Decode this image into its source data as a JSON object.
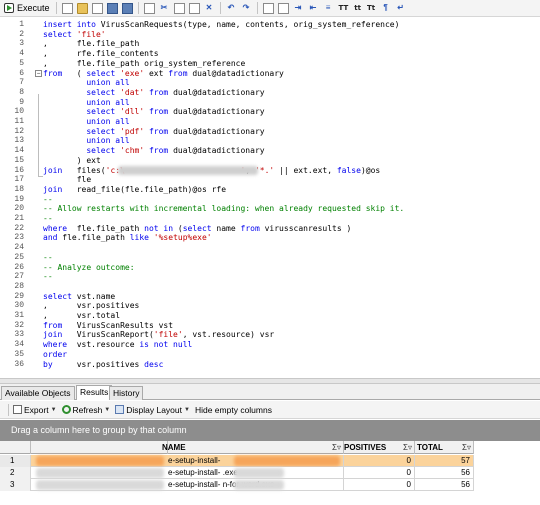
{
  "toolbar": {
    "execute_label": "Execute",
    "tt1": "TT",
    "tt2": "tt",
    "tt3": "Tt"
  },
  "editor": {
    "lines": [
      {
        "n": "1",
        "parts": [
          [
            "kw",
            "insert into "
          ],
          [
            "t",
            "VirusScanRequests(type, name, contents, orig_system_reference)"
          ]
        ]
      },
      {
        "n": "2",
        "parts": [
          [
            "kw",
            "select "
          ],
          [
            "str",
            "'file'"
          ]
        ]
      },
      {
        "n": "3",
        "parts": [
          [
            "t",
            ",      fle.file_path"
          ]
        ]
      },
      {
        "n": "4",
        "parts": [
          [
            "t",
            ",      rfe.file_contents"
          ]
        ]
      },
      {
        "n": "5",
        "parts": [
          [
            "t",
            ",      fle.file_path orig_system_reference"
          ]
        ]
      },
      {
        "n": "6",
        "parts": [
          [
            "kw",
            "from   "
          ],
          [
            "t",
            "( "
          ],
          [
            "kw",
            "select "
          ],
          [
            "str",
            "'exe'"
          ],
          [
            "t",
            " ext "
          ],
          [
            "kw",
            "from "
          ],
          [
            "t",
            "dual@datadictionary"
          ]
        ]
      },
      {
        "n": "7",
        "parts": [
          [
            "kw",
            "         union all"
          ]
        ]
      },
      {
        "n": "8",
        "parts": [
          [
            "kw",
            "         select "
          ],
          [
            "str",
            "'dat'"
          ],
          [
            "kw",
            " from "
          ],
          [
            "t",
            "dual@datadictionary"
          ]
        ]
      },
      {
        "n": "9",
        "parts": [
          [
            "kw",
            "         union all"
          ]
        ]
      },
      {
        "n": "10",
        "parts": [
          [
            "kw",
            "         select "
          ],
          [
            "str",
            "'dll'"
          ],
          [
            "kw",
            " from "
          ],
          [
            "t",
            "dual@datadictionary"
          ]
        ]
      },
      {
        "n": "11",
        "parts": [
          [
            "kw",
            "         union all"
          ]
        ]
      },
      {
        "n": "12",
        "parts": [
          [
            "kw",
            "         select "
          ],
          [
            "str",
            "'pdf'"
          ],
          [
            "kw",
            " from "
          ],
          [
            "t",
            "dual@datadictionary"
          ]
        ]
      },
      {
        "n": "13",
        "parts": [
          [
            "kw",
            "         union all"
          ]
        ]
      },
      {
        "n": "14",
        "parts": [
          [
            "kw",
            "         select "
          ],
          [
            "str",
            "'chm'"
          ],
          [
            "kw",
            " from "
          ],
          [
            "t",
            "dual@datadictionary"
          ]
        ]
      },
      {
        "n": "15",
        "parts": [
          [
            "t",
            "       ) ext"
          ]
        ]
      },
      {
        "n": "16",
        "parts": [
          [
            "kw",
            "join   "
          ],
          [
            "t",
            "files("
          ],
          [
            "str",
            "'c:\\                        '"
          ],
          [
            "t",
            ", "
          ],
          [
            "str",
            "'*.'"
          ],
          [
            "t",
            " || ext.ext, "
          ],
          [
            "kw",
            "false"
          ],
          [
            "t",
            ")@os"
          ]
        ]
      },
      {
        "n": "17",
        "parts": [
          [
            "t",
            "       fle"
          ]
        ]
      },
      {
        "n": "18",
        "parts": [
          [
            "kw",
            "join   "
          ],
          [
            "t",
            "read_file(fle.file_path)@os rfe"
          ]
        ]
      },
      {
        "n": "19",
        "parts": [
          [
            "cm",
            "--"
          ]
        ]
      },
      {
        "n": "20",
        "parts": [
          [
            "cm",
            "-- Allow restarts with incremental loading: when already requested skip it."
          ]
        ]
      },
      {
        "n": "21",
        "parts": [
          [
            "cm",
            "--"
          ]
        ]
      },
      {
        "n": "22",
        "parts": [
          [
            "kw",
            "where  "
          ],
          [
            "t",
            "fle.file_path "
          ],
          [
            "kw",
            "not in "
          ],
          [
            "t",
            "("
          ],
          [
            "kw",
            "select "
          ],
          [
            "t",
            "name "
          ],
          [
            "kw",
            "from "
          ],
          [
            "t",
            "virusscanresults )"
          ]
        ]
      },
      {
        "n": "23",
        "parts": [
          [
            "kw",
            "and "
          ],
          [
            "t",
            "fle.file_path "
          ],
          [
            "kw",
            "like "
          ],
          [
            "str",
            "'%setup%exe'"
          ]
        ]
      },
      {
        "n": "24",
        "parts": []
      },
      {
        "n": "25",
        "parts": [
          [
            "cm",
            "--"
          ]
        ]
      },
      {
        "n": "26",
        "parts": [
          [
            "cm",
            "-- Analyze outcome:"
          ]
        ]
      },
      {
        "n": "27",
        "parts": [
          [
            "cm",
            "--"
          ]
        ]
      },
      {
        "n": "28",
        "parts": []
      },
      {
        "n": "29",
        "parts": [
          [
            "kw",
            "select "
          ],
          [
            "t",
            "vst.name"
          ]
        ]
      },
      {
        "n": "30",
        "parts": [
          [
            "t",
            ",      vsr.positives"
          ]
        ]
      },
      {
        "n": "31",
        "parts": [
          [
            "t",
            ",      vsr.total"
          ]
        ]
      },
      {
        "n": "32",
        "parts": [
          [
            "kw",
            "from   "
          ],
          [
            "t",
            "VirusScanResults vst"
          ]
        ]
      },
      {
        "n": "33",
        "parts": [
          [
            "kw",
            "join   "
          ],
          [
            "t",
            "VirusScanReport("
          ],
          [
            "str",
            "'file'"
          ],
          [
            "t",
            ", vst.resource) vsr"
          ]
        ]
      },
      {
        "n": "34",
        "parts": [
          [
            "kw",
            "where  "
          ],
          [
            "t",
            "vst.resource "
          ],
          [
            "kw",
            "is not null"
          ]
        ]
      },
      {
        "n": "35",
        "parts": [
          [
            "kw",
            "order"
          ]
        ]
      },
      {
        "n": "36",
        "parts": [
          [
            "kw",
            "by     "
          ],
          [
            "t",
            "vsr.positives "
          ],
          [
            "kw",
            "desc"
          ]
        ]
      }
    ]
  },
  "tabs": [
    {
      "label": "Available Objects",
      "active": false
    },
    {
      "label": "Results",
      "active": true
    },
    {
      "label": "History",
      "active": false
    }
  ],
  "results_toolbar": {
    "export": "Export",
    "refresh": "Refresh",
    "display_layout": "Display Layout",
    "hide_empty": "Hide empty columns"
  },
  "group_panel_text": "Drag a column here to group by that column",
  "grid": {
    "columns": [
      "NAME",
      "POSITIVES",
      "TOTAL"
    ],
    "filter_glyph": "Σ▿",
    "rows": [
      {
        "num": "1",
        "name": "e-setup-install-",
        "positives": "0",
        "total": "57",
        "selected": true
      },
      {
        "num": "2",
        "name": "e-setup-install-                          .exe",
        "positives": "0",
        "total": "56",
        "selected": false
      },
      {
        "num": "3",
        "name": "e-setup-install-                          n-for-word.exe",
        "positives": "0",
        "total": "56",
        "selected": false
      }
    ]
  },
  "colors": {
    "keyword": "#0000ee",
    "string": "#c00000",
    "comment": "#008000",
    "selected_row": "#fbd39b",
    "group_panel": "#8d8d8d"
  }
}
